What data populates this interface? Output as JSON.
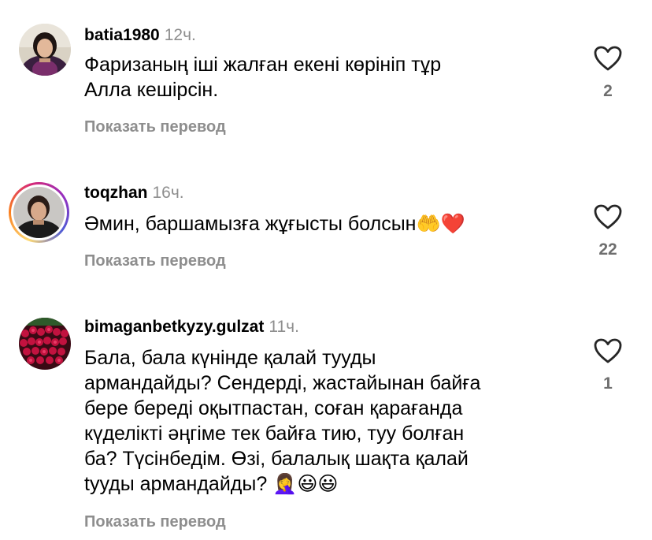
{
  "comments": [
    {
      "username": "batia1980",
      "time": "12ч.",
      "text": "Фаризаның іші жалған екені көрініп тұр\nАлла кешірсін.",
      "translate_label": "Показать перевод",
      "likes": "2"
    },
    {
      "username": "toqzhan",
      "time": "16ч.",
      "text": "Әмин, баршамызға жұғысты болсын🤲❤️",
      "translate_label": "Показать перевод",
      "likes": "22"
    },
    {
      "username": "bimaganbetkyzy.gulzat",
      "time": "11ч.",
      "text": "Бала,  бала күнінде қалай тууды\nармандайды? Сендерді, жастайынан байға\nбере береді оқытпастан, соған қарағанда\nкүделікті әңгіме тек байға тию, туу болған\nба? Түсінбедім. Өзі, балалық шақта қалай\ntууды армандайды? 🤦‍♀️😃😃",
      "translate_label": "Показать перевод",
      "likes": "1"
    }
  ],
  "icons": {
    "like": "heart-outline-icon",
    "avatar_ring_colors": [
      "#feda75",
      "#fa7e1e",
      "#d62976",
      "#962fbf",
      "#4f5bd5"
    ]
  }
}
